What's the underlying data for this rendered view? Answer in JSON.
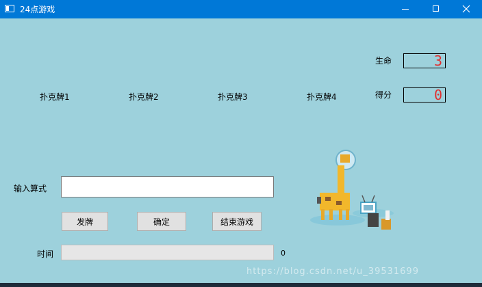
{
  "window": {
    "title": "24点游戏",
    "icon": "app-window-icon",
    "controls": [
      "minimize-icon",
      "maximize-icon",
      "close-icon"
    ]
  },
  "status": {
    "life_label": "生命",
    "life_value": "3",
    "score_label": "得分",
    "score_value": "0",
    "lcd_color": "#e03030"
  },
  "cards": [
    {
      "label": "扑克牌1"
    },
    {
      "label": "扑克牌2"
    },
    {
      "label": "扑克牌3"
    },
    {
      "label": "扑克牌4"
    }
  ],
  "input": {
    "label": "输入算式",
    "value": "",
    "placeholder": ""
  },
  "buttons": {
    "deal": "发牌",
    "confirm": "确定",
    "end": "结束游戏"
  },
  "timer": {
    "label": "时间",
    "value": "0",
    "progress_fraction": 0
  },
  "watermark": "https://blog.csdn.net/u_39531699",
  "colors": {
    "background": "#9dd1dc",
    "titlebar": "#0078d7"
  }
}
